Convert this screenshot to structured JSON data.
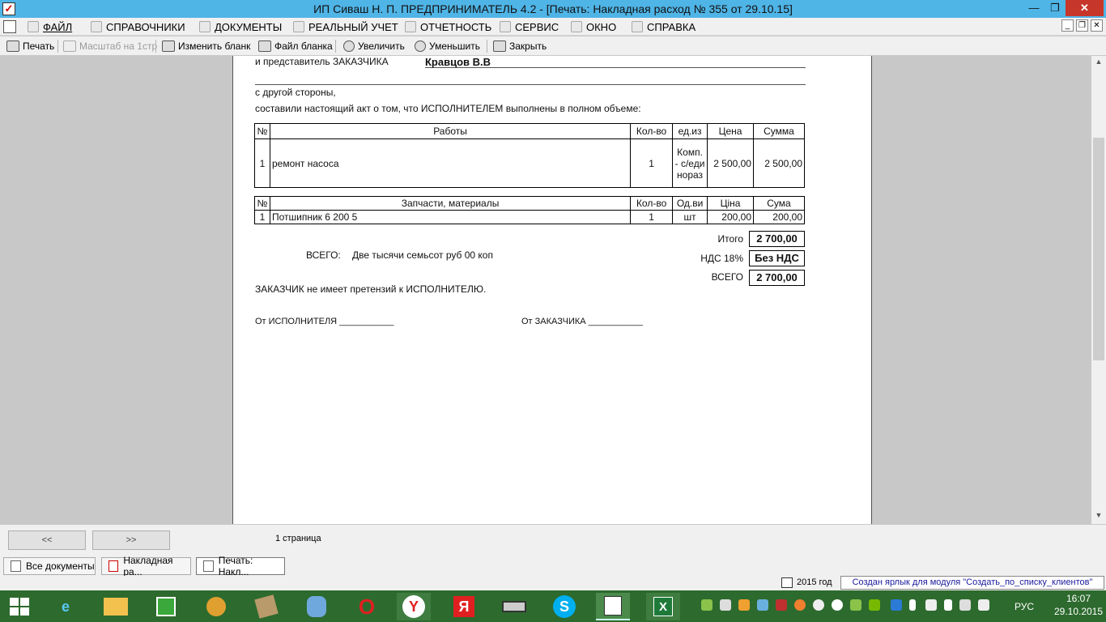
{
  "window": {
    "title": "ИП Сиваш Н. П.  ПРЕДПРИНИМАТЕЛЬ 4.2 - [Печать: Накладная расход № 355 от 29.10.15]",
    "minimize": "—",
    "maximize": "❐",
    "close": "✕"
  },
  "menu": {
    "items": [
      {
        "label": "ФАЙЛ",
        "icon": "folder-icon"
      },
      {
        "label": "СПРАВОЧНИКИ",
        "icon": "house-icon"
      },
      {
        "label": "ДОКУМЕНТЫ",
        "icon": "document-icon"
      },
      {
        "label": "РЕАЛЬНЫЙ УЧЕТ",
        "icon": "calculator-icon"
      },
      {
        "label": "ОТЧЕТНОСТЬ",
        "icon": "report-icon"
      },
      {
        "label": "СЕРВИС",
        "icon": "service-icon"
      },
      {
        "label": "ОКНО",
        "icon": "window-icon"
      },
      {
        "label": "СПРАВКА",
        "icon": "help-icon"
      }
    ],
    "mdi_minimize": "_",
    "mdi_restore": "❐",
    "mdi_close": "✕"
  },
  "toolbar": {
    "print": "Печать",
    "scale": "Масштаб на 1стр",
    "edit_form": "Изменить бланк",
    "form_file": "Файл бланка",
    "zoom_in": "Увеличить",
    "zoom_out": "Уменьшить",
    "close": "Закрыть"
  },
  "document": {
    "rep_label": "и представитель ЗАКАЗЧИКА",
    "rep_name": "Кравцов В.В",
    "other_side": "с другой стороны,",
    "act_text": "составили настоящий акт о том, что ИСПОЛНИТЕЛЕМ выполнены в полном объеме:",
    "works": {
      "headers": [
        "№",
        "Работы",
        "Кол-во",
        "ед.из",
        "Цена",
        "Сумма"
      ],
      "rows": [
        {
          "n": "1",
          "name": "ремонт насоса",
          "qty": "1",
          "unit": "Комп. - с/еди нораз",
          "price": "2 500,00",
          "sum": "2 500,00"
        }
      ]
    },
    "parts": {
      "headers": [
        "№",
        "Запчасти, материалы",
        "Кол-во",
        "Од.ви",
        "Ціна",
        "Сума"
      ],
      "rows": [
        {
          "n": "1",
          "name": "Потшипник 6 200 5",
          "qty": "1",
          "unit": "шт",
          "price": "200,00",
          "sum": "200,00"
        }
      ]
    },
    "itogo_label": "Итого",
    "itogo_value": "2 700,00",
    "vat_label": "НДС 18%",
    "vat_value": "Без НДС",
    "total_label": "ВСЕГО",
    "total_value": "2 700,00",
    "words_label": "ВСЕГО:",
    "words_value": "Две тысячи семьсот руб 00 коп",
    "no_claims": "ЗАКАЗЧИК не имеет претензий к ИСПОЛНИТЕЛЮ.",
    "from_executor": "От ИСПОЛНИТЕЛЯ ___________",
    "from_customer": "От ЗАКАЗЧИКА  ___________"
  },
  "pager": {
    "prev": "<<",
    "next": ">>",
    "pages": "1 страница"
  },
  "tabs": [
    {
      "label": "Все документы",
      "icon": "stack-icon"
    },
    {
      "label": "Накладная ра...",
      "icon": "invoice-icon"
    },
    {
      "label": "Печать: Накл...",
      "icon": "print-preview-icon"
    }
  ],
  "status": {
    "year": "2015 год",
    "message": "Создан ярлык для модуля \"Создать_по_списку_клиентов\""
  },
  "taskbar": {
    "lang": "РУС",
    "time": "16:07",
    "date": "29.10.2015",
    "colors": {
      "background": "#2d6a2e",
      "accent": "#4fb4e6"
    }
  }
}
